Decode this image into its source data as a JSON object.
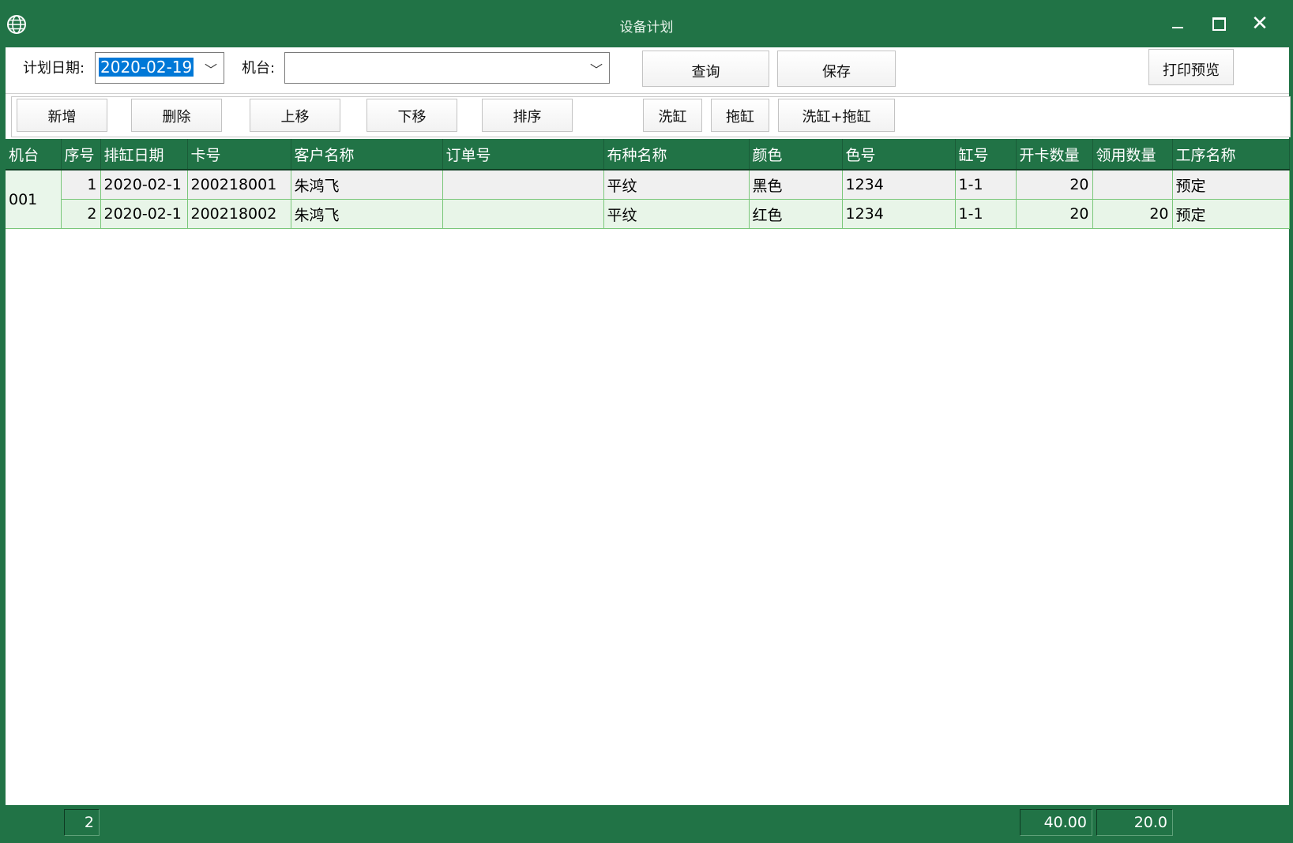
{
  "window": {
    "title": "设备计划"
  },
  "filters": {
    "plan_date_label": "计划日期:",
    "plan_date_value": "2020-02-19",
    "machine_label": "机台:",
    "machine_value": ""
  },
  "toolbar1": {
    "query": "查询",
    "save": "保存",
    "print_preview": "打印预览"
  },
  "toolbar2": {
    "add": "新增",
    "delete": "删除",
    "move_up": "上移",
    "move_down": "下移",
    "sort": "排序",
    "wash": "洗缸",
    "drag": "拖缸",
    "wash_drag": "洗缸+拖缸"
  },
  "table": {
    "columns": [
      "机台",
      "序号",
      "排缸日期",
      "卡号",
      "客户名称",
      "订单号",
      "布种名称",
      "颜色",
      "色号",
      "缸号",
      "开卡数量",
      "领用数量",
      "工序名称"
    ],
    "machine": "001",
    "rows": [
      {
        "seq": "1",
        "date": "2020-02-1",
        "card": "200218001",
        "customer": "朱鸿飞",
        "order": "",
        "fabric": "平纹",
        "color": "黑色",
        "color_no": "1234",
        "vat": "1-1",
        "open_qty": "20",
        "use_qty": "",
        "process": "预定"
      },
      {
        "seq": "2",
        "date": "2020-02-1",
        "card": "200218002",
        "customer": "朱鸿飞",
        "order": "",
        "fabric": "平纹",
        "color": "红色",
        "color_no": "1234",
        "vat": "1-1",
        "open_qty": "20",
        "use_qty": "20",
        "process": "预定"
      }
    ]
  },
  "footer": {
    "count": "2",
    "open_total": "40.00",
    "use_total": "20.0"
  },
  "colors": {
    "accent": "#217346",
    "row_even": "#f0f0f0",
    "row_odd": "#e8f5e8",
    "grid_line": "#7ac77a"
  }
}
